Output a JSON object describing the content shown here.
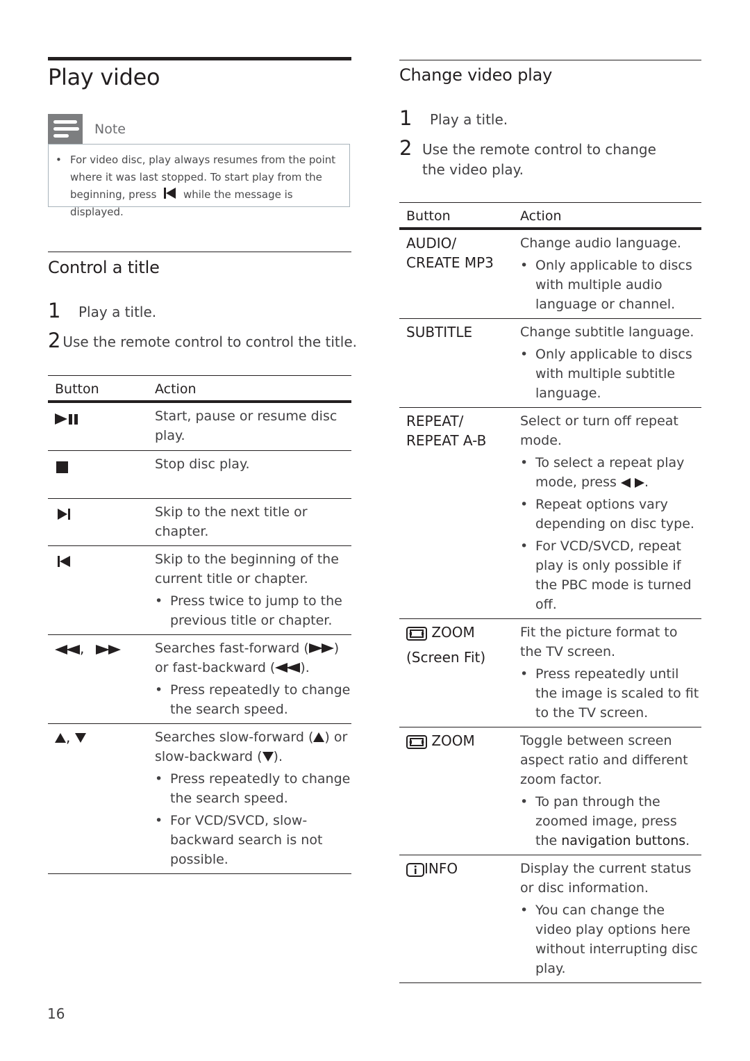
{
  "left": {
    "title": "Play video",
    "note": {
      "label": "Note",
      "bullet": "•",
      "text_before_icon": "For video disc, play always resumes from the point where it was last stopped. To start play from the beginning, press",
      "icon": "previous-icon",
      "text_after_icon": "while the message is displayed."
    },
    "section_title": "Control a title",
    "steps": [
      {
        "num": "1",
        "text": "Play a title."
      },
      {
        "num": "2",
        "text": "Use the remote control to control the title."
      }
    ],
    "table": {
      "headers": [
        "Button",
        "Action"
      ],
      "rows": [
        {
          "button_icon": "play-pause-icon",
          "action": "Start, pause or resume disc play.",
          "bullets": []
        },
        {
          "button_icon": "stop-icon",
          "action": "Stop disc play.",
          "bullets": []
        },
        {
          "button_icon": "next-icon",
          "action": "Skip to the next title or chapter.",
          "bullets": []
        },
        {
          "button_icon": "previous-icon",
          "action": "Skip to the beginning of the current title or chapter.",
          "bullets": [
            "Press twice to jump to the previous title or chapter."
          ]
        },
        {
          "button_icon": "fast-backward-fast-forward-icons",
          "button_sep": ",",
          "action_parts": [
            "Searches fast-forward (",
            ") or fast-backward (",
            ")."
          ],
          "bullets": [
            "Press repeatedly to change the search speed."
          ]
        },
        {
          "button_icon": "up-down-icons",
          "button_sep": ",",
          "action_parts": [
            "Searches slow-forward (",
            ") or slow-backward (",
            ")."
          ],
          "bullets": [
            "Press repeatedly to change the search speed.",
            "For VCD/SVCD, slow-backward search is not possible."
          ]
        }
      ]
    }
  },
  "right": {
    "section_title": "Change video play",
    "steps": [
      {
        "num": "1",
        "text": "Play a title."
      },
      {
        "num": "2",
        "text": "Use the remote control to change the video play."
      }
    ],
    "table": {
      "headers": [
        "Button",
        "Action"
      ],
      "rows": [
        {
          "button": "AUDIO/ CREATE MP3",
          "action": "Change audio language.",
          "bullets": [
            "Only applicable to discs with multiple audio language or channel."
          ]
        },
        {
          "button": "SUBTITLE",
          "action": "Change subtitle language.",
          "bullets": [
            "Only applicable to discs with multiple subtitle language."
          ]
        },
        {
          "button": "REPEAT/ REPEAT A-B",
          "action": "Select or turn off repeat mode.",
          "bullets": [
            "To select a repeat play mode, press",
            "Repeat options vary depending on disc type.",
            "For VCD/SVCD, repeat play is only possible if the PBC mode is turned off."
          ],
          "bullet0_suffix": "."
        },
        {
          "button": "ZOOM",
          "button_sub": "(Screen Fit)",
          "button_icon": "zoom-icon",
          "action": "Fit the picture format to the TV screen.",
          "bullets": [
            "Press repeatedly until the image is scaled to fit to the TV screen."
          ]
        },
        {
          "button": "ZOOM",
          "button_icon": "zoom-icon",
          "action": "Toggle between screen aspect ratio and different zoom factor.",
          "bullets": [
            "To pan through the zoomed image, press the"
          ],
          "bullet0_bold": "navigation buttons",
          "bullet0_suffix": "."
        },
        {
          "button": "INFO",
          "button_icon": "info-icon",
          "action": "Display the current status or disc information.",
          "bullets": [
            "You can change the video play options here without interrupting disc play."
          ]
        }
      ]
    }
  },
  "footer": {
    "page_number": "16"
  }
}
